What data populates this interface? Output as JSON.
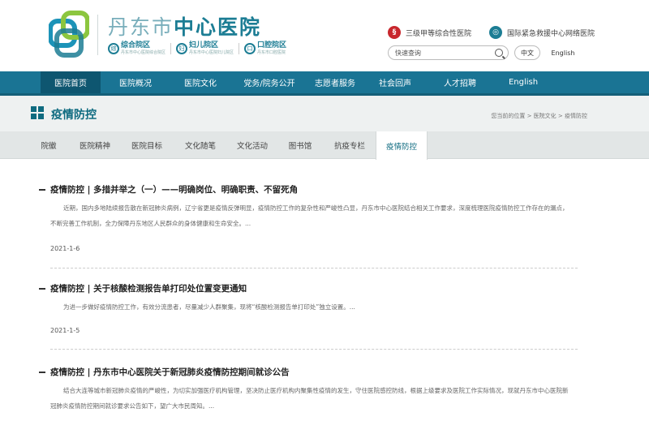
{
  "header": {
    "title_pre": "丹东市",
    "title_main": "中心医院",
    "campuses": [
      {
        "icon": "综",
        "name": "综合院区",
        "sub": "丹东市中心医院综合院区"
      },
      {
        "icon": "妇",
        "name": "妇儿院区",
        "sub": "丹东市中心医院妇儿院区"
      },
      {
        "icon": "口",
        "name": "口腔院区",
        "sub": "丹东市口腔医院"
      }
    ],
    "badge1": "三级甲等综合性医院",
    "badge2": "国际紧急救援中心网络医院",
    "search_placeholder": "快速查询",
    "lang_cn": "中文",
    "lang_en": "English"
  },
  "nav": {
    "items": [
      "医院首页",
      "医院概况",
      "医院文化",
      "党务/院务公开",
      "志愿者服务",
      "社会回声",
      "人才招聘",
      "English"
    ],
    "active_index": 0
  },
  "section": {
    "title": "疫情防控",
    "breadcrumb": "您当前的位置 > 医院文化 > 疫情防控"
  },
  "subtabs": {
    "items": [
      "院徽",
      "医院精神",
      "医院目标",
      "文化随笔",
      "文化活动",
      "图书馆",
      "抗疫专栏",
      "疫情防控"
    ],
    "active_index": 7
  },
  "articles": [
    {
      "title": "疫情防控 | 多措并举之（一）——明确岗位、明确职责、不留死角",
      "desc": "近期，国内多地陆续报告散在新冠肺炎病例，辽宁省更是疫情反弹明显，疫情防控工作的复杂性和严峻性凸显，丹东市中心医院结合相关工作要求，深度梳理医院疫情防控工作存在的漏点，不断完善工作机制，全力保障丹东地区人民群众的身体健康和生命安全。...",
      "date": "2021-1-6"
    },
    {
      "title": "疫情防控 | 关于核酸检测报告单打印处位置变更通知",
      "desc": "为进一步做好疫情防控工作，有效分流患者，尽量减少人群聚集，现将“核酸检测报告单打印处”独立设置。...",
      "date": "2021-1-5"
    },
    {
      "title": "疫情防控 | 丹东市中心医院关于新冠肺炎疫情防控期间就诊公告",
      "desc": "结合大连等城市新冠肺炎疫情的严峻性，为切实加强医疗机构管理，坚决防止医疗机构内聚集性疫情的发生，守住医院感控防线，根据上级要求及医院工作实际情况，现就丹东市中心医院新冠肺炎疫情防控期间就诊要求公告如下，望广大市民周知。..."
    }
  ],
  "colors": {
    "brand": "#1a7494",
    "brand_dark": "#0f6b80",
    "accent_green": "#7bbf3a",
    "badge_red": "#c8272d"
  }
}
